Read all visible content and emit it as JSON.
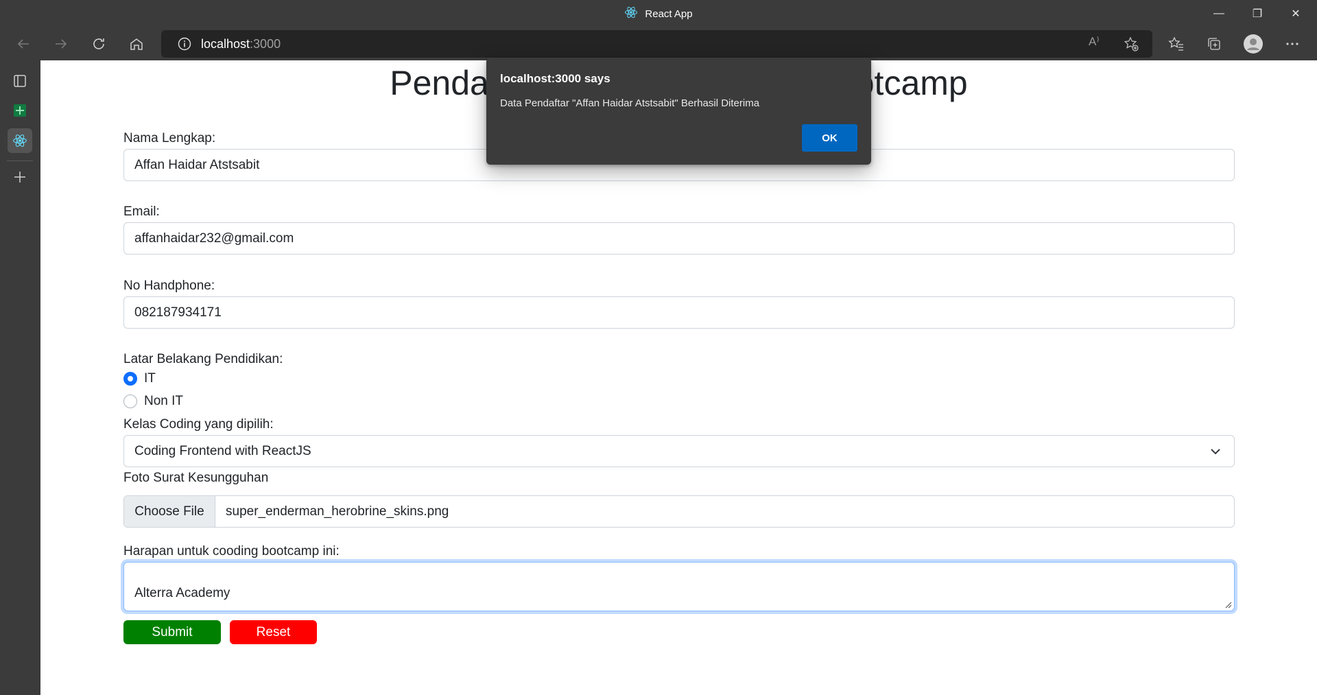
{
  "window": {
    "title": "React App",
    "minimize": "—",
    "restore": "❐",
    "close": "✕"
  },
  "browser": {
    "address_host": "localhost",
    "address_port": ":3000",
    "read_aloud_label": "A⁾"
  },
  "page": {
    "title_full": "Pendaftaran Peserta Coding Bootcamp",
    "title_visible_left": "Pendaf",
    "title_visible_right": "otcamp",
    "form": {
      "nama_label": "Nama Lengkap:",
      "nama_value": "Affan Haidar Atstsabit",
      "email_label": "Email:",
      "email_value": "affanhaidar232@gmail.com",
      "hp_label": "No Handphone:",
      "hp_value": "082187934171",
      "pendidikan_label": "Latar Belakang Pendidikan:",
      "pendidikan_options": [
        {
          "label": "IT",
          "checked": true
        },
        {
          "label": "Non IT",
          "checked": false
        }
      ],
      "kelas_label": "Kelas Coding yang dipilih:",
      "kelas_value": "Coding Frontend with ReactJS",
      "foto_label": "Foto Surat Kesungguhan",
      "file_button": "Choose File",
      "file_name": "super_enderman_herobrine_skins.png",
      "harapan_label": "Harapan untuk cooding bootcamp ini:",
      "harapan_value": "Alterra Academy",
      "submit_label": "Submit",
      "reset_label": "Reset"
    }
  },
  "dialog": {
    "title": "localhost:3000 says",
    "message": "Data Pendaftar \"Affan Haidar Atstsabit\" Berhasil Diterima",
    "ok_label": "OK"
  },
  "colors": {
    "chrome": "#3b3b3b",
    "address_bg": "#242424",
    "submit": "#008000",
    "reset": "#ff0000",
    "dialog_ok": "#0067c0",
    "radio_checked": "#0d6efd"
  }
}
